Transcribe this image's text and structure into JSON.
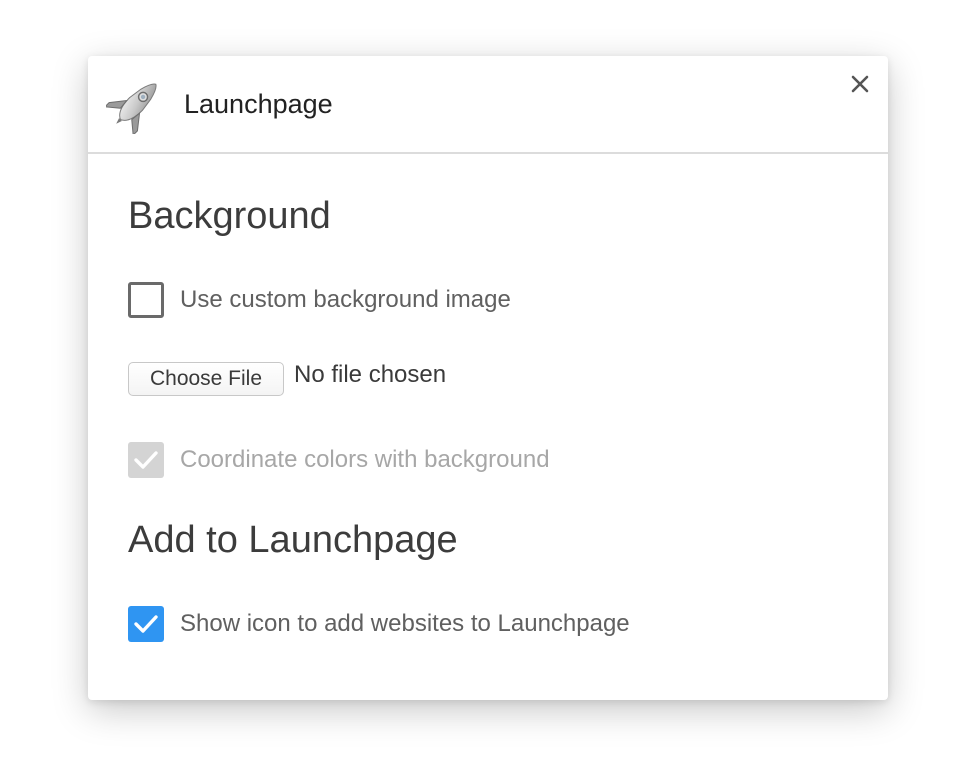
{
  "header": {
    "title": "Launchpage",
    "app_icon": "rocket-icon",
    "close_icon": "close-icon"
  },
  "background_section": {
    "title": "Background",
    "custom_image": {
      "label": "Use custom background image",
      "checked": false
    },
    "file_picker": {
      "button_label": "Choose File",
      "status": "No file chosen"
    },
    "coordinate_colors": {
      "label": "Coordinate colors with background",
      "checked": true,
      "disabled": true
    }
  },
  "add_section": {
    "title": "Add to Launchpage",
    "show_icon": {
      "label": "Show icon to add websites to Launchpage",
      "checked": true
    }
  },
  "colors": {
    "accent": "#2f95f2",
    "disabled_checkbox": "#d4d4d4",
    "divider": "#dcdcdc"
  }
}
